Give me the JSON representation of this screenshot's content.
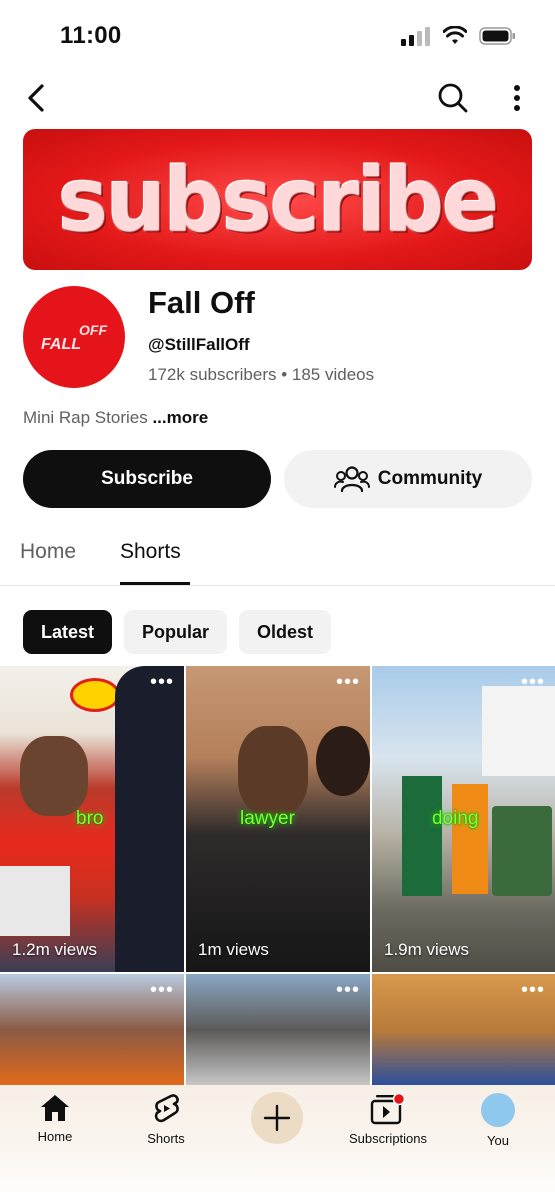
{
  "status_bar": {
    "time": "11:00"
  },
  "banner": {
    "text": "subscribe"
  },
  "channel": {
    "name": "Fall Off",
    "handle": "@StillFallOff",
    "stats": "172k subscribers • 185 videos",
    "description": "Mini Rap Stories",
    "more_label": "...more",
    "avatar_text_top": "OFF",
    "avatar_text_bottom": "FALL"
  },
  "actions": {
    "subscribe_label": "Subscribe",
    "community_label": "Community"
  },
  "tabs": [
    {
      "label": "Home"
    },
    {
      "label": "Shorts"
    }
  ],
  "chips": [
    {
      "label": "Latest"
    },
    {
      "label": "Popular"
    },
    {
      "label": "Oldest"
    }
  ],
  "shorts": [
    {
      "views": "1.2m views",
      "caption": "bro"
    },
    {
      "views": "1m views",
      "caption": "lawyer"
    },
    {
      "views": "1.9m views",
      "caption": "doing"
    },
    {
      "views": "",
      "caption": ""
    },
    {
      "views": "",
      "caption": ""
    },
    {
      "views": "",
      "caption": ""
    }
  ],
  "bottom_nav": {
    "home": "Home",
    "shorts": "Shorts",
    "subscriptions": "Subscriptions",
    "you": "You"
  },
  "colors": {
    "brand_red": "#e5141a",
    "accent_dot": "#e5141a",
    "text_primary": "#0f0f0f",
    "text_secondary": "#606060"
  }
}
